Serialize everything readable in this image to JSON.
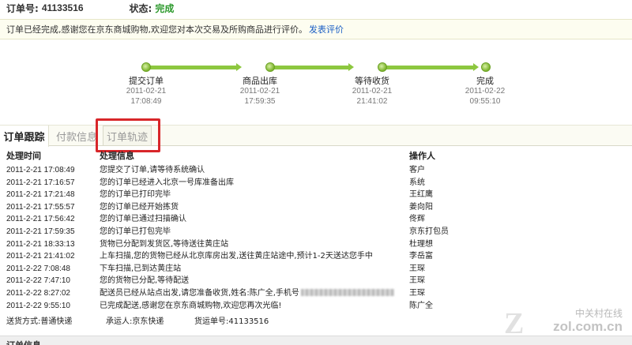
{
  "order": {
    "number_label": "订单号:",
    "number": "41133516",
    "status_label": "状态:",
    "status": "完成"
  },
  "notice": {
    "text": "订单已经完成,感谢您在京东商城购物,欢迎您对本次交易及所购商品进行评价。",
    "link": "发表评价"
  },
  "progress": {
    "steps": [
      {
        "name": "提交订单",
        "date": "2011-02-21",
        "time": "17:08:49"
      },
      {
        "name": "商品出库",
        "date": "2011-02-21",
        "time": "17:59:35"
      },
      {
        "name": "等待收货",
        "date": "2011-02-21",
        "time": "21:41:02"
      },
      {
        "name": "完成",
        "date": "2011-02-22",
        "time": "09:55:10"
      }
    ]
  },
  "tabs": [
    {
      "label": "订单跟踪"
    },
    {
      "label": "付款信息"
    },
    {
      "label": "订单轨迹"
    }
  ],
  "log": {
    "headers": {
      "time": "处理时间",
      "info": "处理信息",
      "operator": "操作人"
    },
    "rows": [
      {
        "time": "2011-2-21 17:08:49",
        "info": "您提交了订单,请等待系统确认",
        "operator": "客户"
      },
      {
        "time": "2011-2-21 17:16:57",
        "info": "您的订单已经进入北京一号库准备出库",
        "operator": "系统"
      },
      {
        "time": "2011-2-21 17:21:48",
        "info": "您的订单已打印完毕",
        "operator": "王红鹰"
      },
      {
        "time": "2011-2-21 17:55:57",
        "info": "您的订单已经开始拣货",
        "operator": "姜向阳"
      },
      {
        "time": "2011-2-21 17:56:42",
        "info": "您的订单已通过扫描确认",
        "operator": "佟辉"
      },
      {
        "time": "2011-2-21 17:59:35",
        "info": "您的订单已打包完毕",
        "operator": "京东打包员"
      },
      {
        "time": "2011-2-21 18:33:13",
        "info": "货物已分配到发货区,等待送往黄庄站",
        "operator": "杜理想"
      },
      {
        "time": "2011-2-21 21:41:02",
        "info": "上车扫描,您的货物已经从北京库房出发,送往黄庄站途中,预计1-2天送达您手中",
        "operator": "李岳富"
      },
      {
        "time": "2011-2-22 7:08:48",
        "info": "下车扫描,已到达黄庄站",
        "operator": "王琛"
      },
      {
        "time": "2011-2-22 7:47:10",
        "info": "您的货物已分配,等待配送",
        "operator": "王琛"
      },
      {
        "time": "2011-2-22 8:27:02",
        "info": "配送员已经从站点出发,请您准备收货,姓名:陈广全,手机号",
        "operator": "王琛"
      },
      {
        "time": "2011-2-22 9:55:10",
        "info": "已完成配送,感谢您在京东商城购物,欢迎您再次光临!",
        "operator": "陈广全"
      }
    ]
  },
  "shipping": {
    "method": "送货方式:普通快递",
    "carrier": "承运人:京东快递",
    "tracking": "货运单号:41133516"
  },
  "bottom": {
    "title": "订单信息"
  },
  "watermark": {
    "text": "中关村在线",
    "url": "zol.com.cn"
  },
  "colors": {
    "status_green": "#2e9a2e",
    "progress_green": "#8dc73f",
    "link_blue": "#1a5ec4",
    "highlight_red": "#d8262a"
  }
}
